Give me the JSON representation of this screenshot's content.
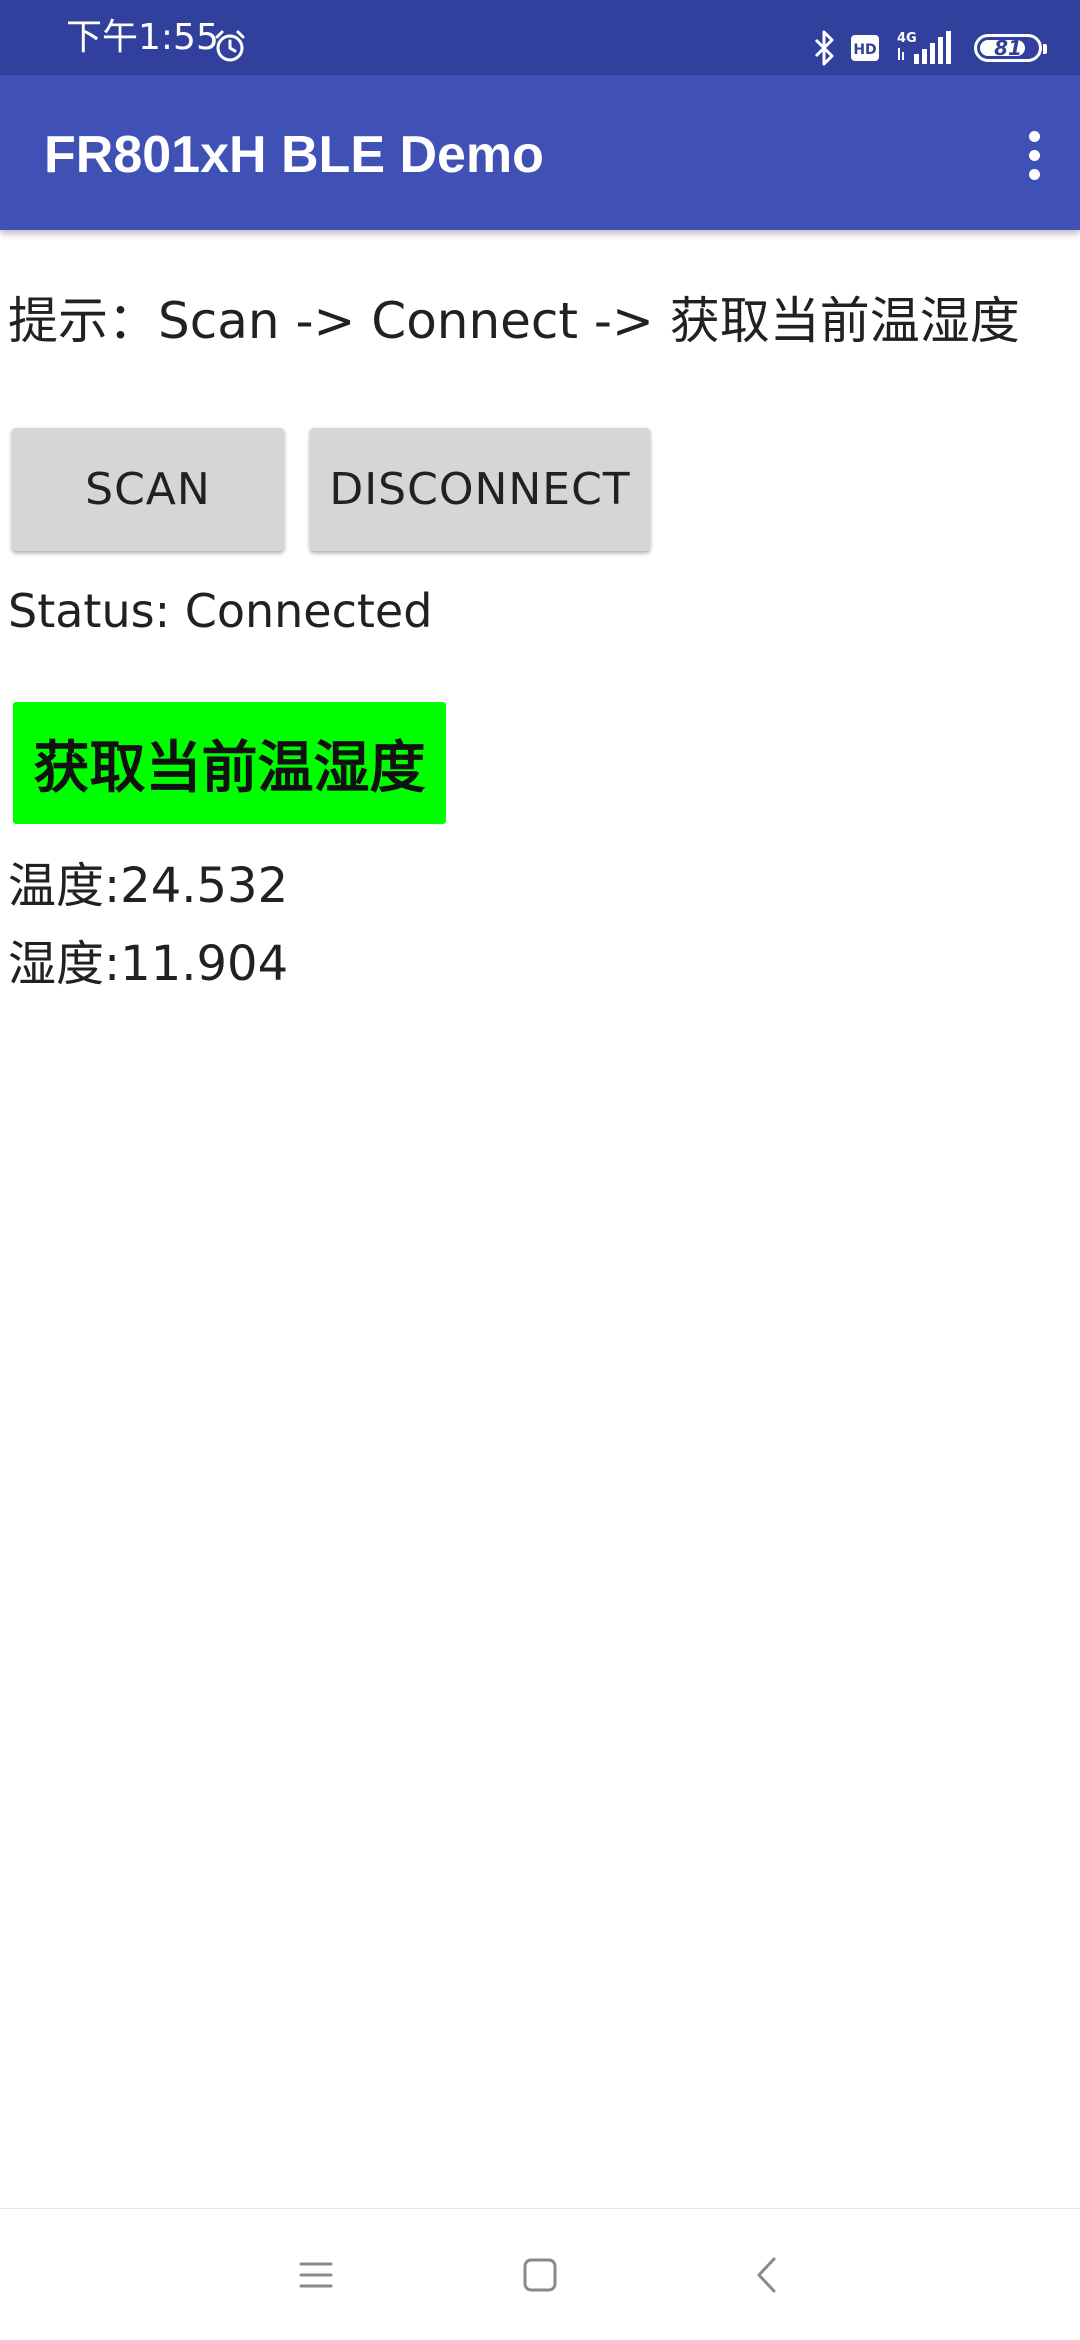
{
  "status_bar": {
    "time": "下午1:55",
    "network": "4G",
    "hd_label": "HD",
    "battery_level": "81",
    "battery_fraction": 0.81,
    "icons": [
      "alarm-icon",
      "bluetooth-icon",
      "hd-icon",
      "signal-icon",
      "battery-icon"
    ]
  },
  "app_bar": {
    "title": "FR801xH BLE Demo",
    "menu_icon": "overflow-menu-icon"
  },
  "main": {
    "hint": "提示：Scan -> Connect -> 获取当前温湿度",
    "scan_label": "SCAN",
    "disconnect_label": "DISCONNECT",
    "status": "Status: Connected",
    "fetch_label": "获取当前温湿度",
    "temperature": "温度:24.532",
    "humidity": "湿度:11.904"
  },
  "colors": {
    "status_bar": "#30409c",
    "app_bar": "#3f51b5",
    "fetch_button": "#00ff00",
    "button_gray": "#d6d6d6"
  },
  "nav_bar": {
    "icons": [
      "menu-icon",
      "home-icon",
      "back-icon"
    ]
  }
}
